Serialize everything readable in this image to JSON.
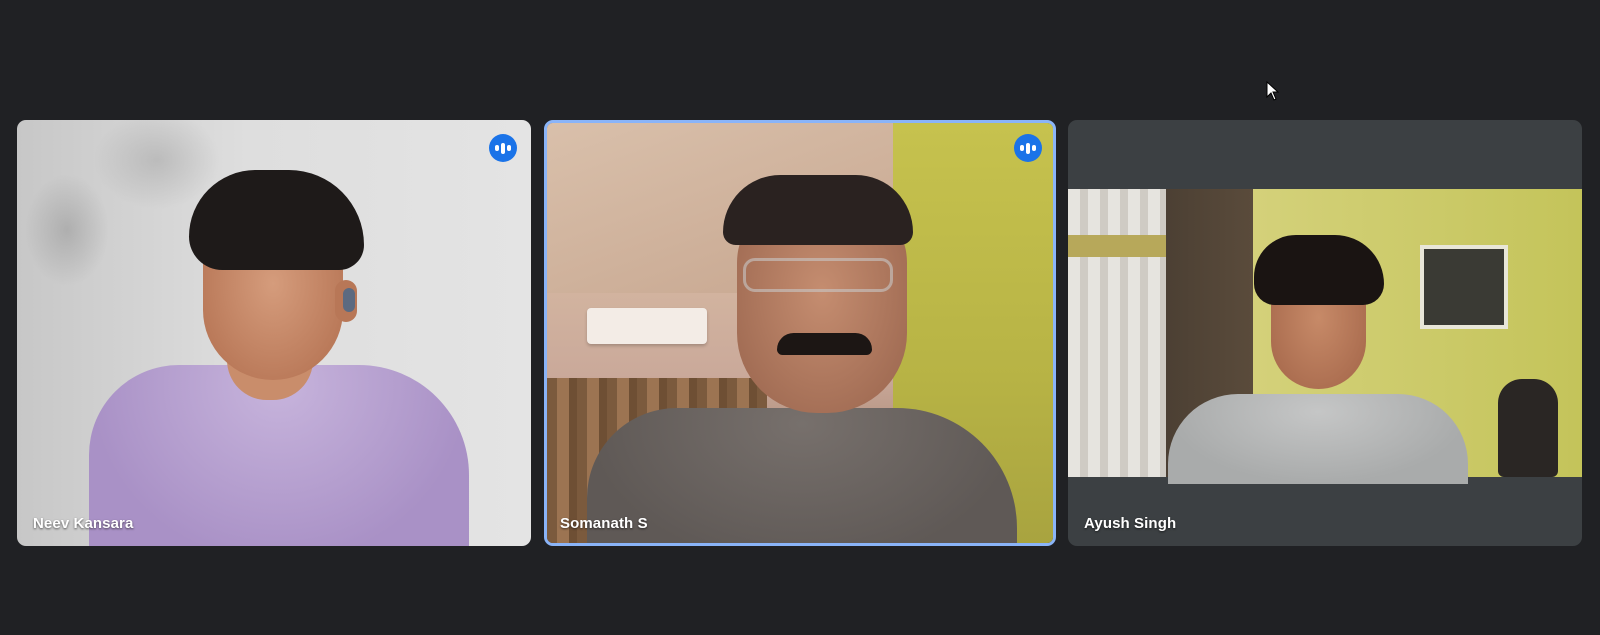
{
  "participants": [
    {
      "name": "Neev Kansara",
      "speaking_icon": "audio-level-icon",
      "active_speaker": false
    },
    {
      "name": "Somanath S",
      "speaking_icon": "audio-level-icon",
      "active_speaker": true
    },
    {
      "name": "Ayush Singh",
      "speaking_icon": null,
      "active_speaker": false
    }
  ],
  "colors": {
    "background": "#202124",
    "tile_grey": "#3c4043",
    "active_border": "#8ab4f8",
    "speaking_badge": "#1a73e8"
  },
  "icons": {
    "cursor": "mouse-pointer-icon"
  }
}
